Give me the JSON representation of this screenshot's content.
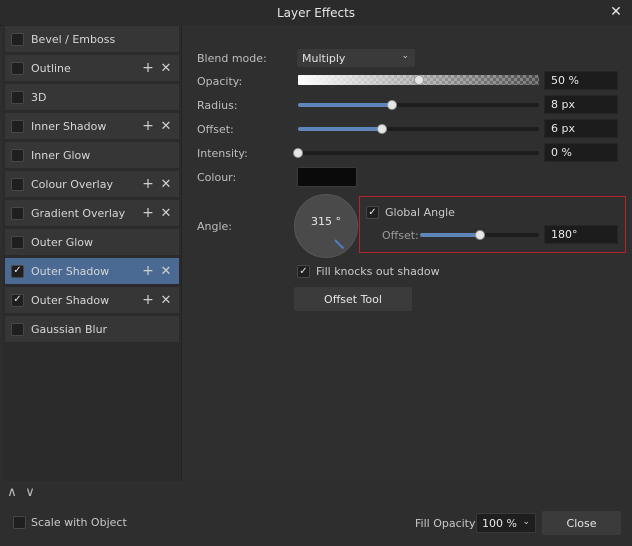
{
  "window": {
    "title": "Layer Effects",
    "close_glyph": "✕"
  },
  "effects": [
    {
      "label": "Bevel / Emboss",
      "checked": false,
      "actions": false
    },
    {
      "label": "Outline",
      "checked": false,
      "actions": true
    },
    {
      "label": "3D",
      "checked": false,
      "actions": false
    },
    {
      "label": "Inner Shadow",
      "checked": false,
      "actions": true
    },
    {
      "label": "Inner Glow",
      "checked": false,
      "actions": false
    },
    {
      "label": "Colour Overlay",
      "checked": false,
      "actions": true
    },
    {
      "label": "Gradient Overlay",
      "checked": false,
      "actions": true
    },
    {
      "label": "Outer Glow",
      "checked": false,
      "actions": false
    },
    {
      "label": "Outer Shadow",
      "checked": true,
      "actions": true,
      "selected": true
    },
    {
      "label": "Outer Shadow",
      "checked": true,
      "actions": true
    },
    {
      "label": "Gaussian Blur",
      "checked": false,
      "actions": false
    }
  ],
  "icons": {
    "add": "+",
    "remove": "✕",
    "check": "✓",
    "up": "∧",
    "down": "∨",
    "chevron": "⌄"
  },
  "settings": {
    "blend_mode_label": "Blend mode:",
    "blend_mode_value": "Multiply",
    "opacity_label": "Opacity:",
    "opacity_value": "50 %",
    "opacity_fraction": 0.5,
    "radius_label": "Radius:",
    "radius_value": "8 px",
    "radius_fraction": 0.39,
    "offset_label": "Offset:",
    "offset_value": "6 px",
    "offset_fraction": 0.35,
    "intensity_label": "Intensity:",
    "intensity_value": "0 %",
    "intensity_fraction": 0.0,
    "colour_label": "Colour:",
    "colour_value": "#0a0a0a",
    "angle_label": "Angle:",
    "angle_value": "315 °",
    "global_angle_label": "Global Angle",
    "global_angle_checked": true,
    "global_offset_label": "Offset:",
    "global_offset_value": "180°",
    "global_offset_fraction": 0.5,
    "fill_knocks_label": "Fill knocks out shadow",
    "fill_knocks_checked": true,
    "offset_tool_label": "Offset Tool"
  },
  "footer": {
    "scale_label": "Scale with Object",
    "scale_checked": false,
    "fill_opacity_label": "Fill Opacity:",
    "fill_opacity_value": "100 %",
    "close_label": "Close"
  },
  "colors": {
    "accent": "#5f86bb",
    "selected_row": "#4a6a93",
    "highlight_border": "#b3242b"
  }
}
